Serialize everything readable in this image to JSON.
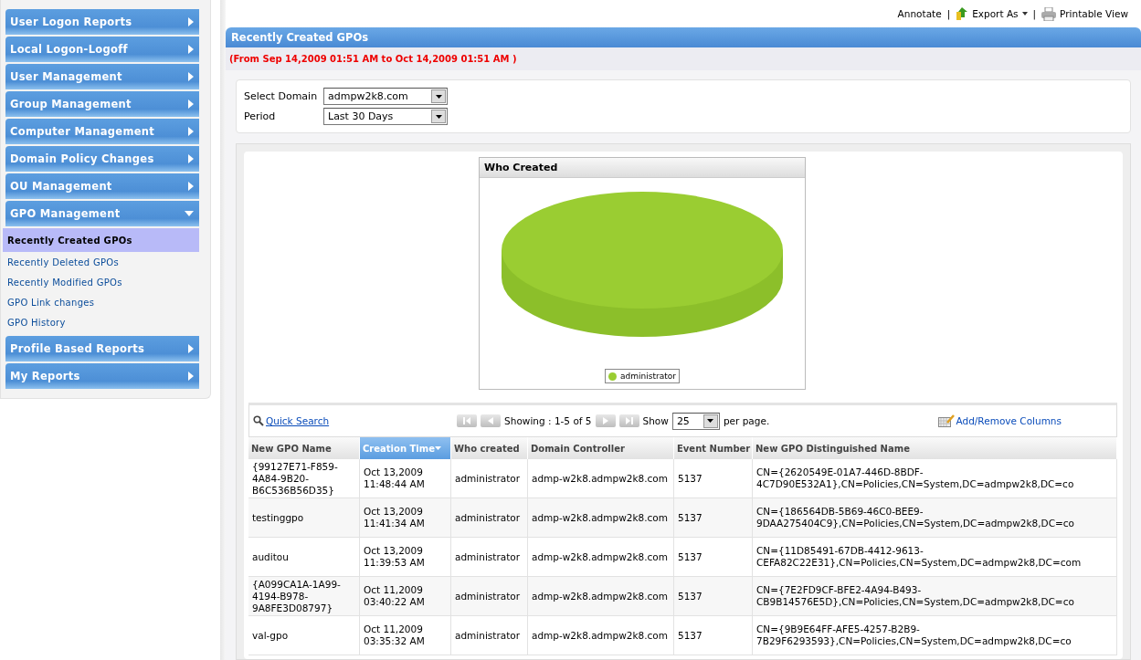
{
  "sidebar": {
    "items": [
      {
        "label": "User Logon Reports",
        "expanded": false
      },
      {
        "label": "Local Logon-Logoff",
        "expanded": false
      },
      {
        "label": "User Management",
        "expanded": false
      },
      {
        "label": "Group Management",
        "expanded": false
      },
      {
        "label": "Computer Management",
        "expanded": false
      },
      {
        "label": "Domain Policy Changes",
        "expanded": false
      },
      {
        "label": "OU Management",
        "expanded": false
      },
      {
        "label": "GPO Management",
        "expanded": true,
        "children": [
          {
            "label": "Recently Created GPOs",
            "selected": true
          },
          {
            "label": "Recently Deleted GPOs",
            "selected": false
          },
          {
            "label": "Recently Modified GPOs",
            "selected": false
          },
          {
            "label": "GPO Link changes",
            "selected": false
          },
          {
            "label": "GPO History",
            "selected": false
          }
        ]
      },
      {
        "label": "Profile Based Reports",
        "expanded": false
      },
      {
        "label": "My Reports",
        "expanded": false
      }
    ]
  },
  "top_links": [
    {
      "label": "Annotate",
      "kind": "text"
    },
    {
      "label": "|",
      "kind": "separator"
    },
    {
      "label": "Export As",
      "kind": "export"
    },
    {
      "label": "|",
      "kind": "separator"
    },
    {
      "label": "Printable View",
      "kind": "print"
    }
  ],
  "report": {
    "title": "Recently Created GPOs",
    "period_note": "(From Sep 14,2009 01:51 AM to Oct 14,2009 01:51 AM )"
  },
  "filters": [
    {
      "label": "Select Domain",
      "value": "admpw2k8.com"
    },
    {
      "label": "Period",
      "value": "Last 30 Days"
    }
  ],
  "chart": {
    "title": "Who Created",
    "legend": [
      {
        "label": "administrator",
        "color": "#9acd32"
      }
    ]
  },
  "table_toolbar": {
    "quick_search": "Quick Search",
    "showing": "Showing : 1-5 of 5",
    "show_label": "Show",
    "page_size": "25",
    "per_page": "per page.",
    "add_remove": "Add/Remove Columns"
  },
  "table": {
    "columns": [
      {
        "label": "New GPO Name",
        "selected": false
      },
      {
        "label": "Creation Time",
        "selected": true
      },
      {
        "label": "Who created",
        "selected": false
      },
      {
        "label": "Domain Controller",
        "selected": false
      },
      {
        "label": "Event Number",
        "selected": false
      },
      {
        "label": "New GPO Distinguished Name",
        "selected": false
      }
    ],
    "rows": [
      [
        "{99127E71-F859-4A84-9B20-B6C536B56D35}",
        "Oct 13,2009 11:48:44 AM",
        "administrator",
        "admp-w2k8.admpw2k8.com",
        "5137",
        "CN={2620549E-01A7-446D-8BDF-4C7D90E532A1},CN=Policies,CN=System,DC=admpw2k8,DC=co"
      ],
      [
        "testinggpo",
        "Oct 13,2009 11:41:34 AM",
        "administrator",
        "admp-w2k8.admpw2k8.com",
        "5137",
        "CN={186564DB-5B69-46C0-BEE9-9DAA275404C9},CN=Policies,CN=System,DC=admpw2k8,DC=co"
      ],
      [
        "auditou",
        "Oct 13,2009 11:39:53 AM",
        "administrator",
        "admp-w2k8.admpw2k8.com",
        "5137",
        "CN={11D85491-67DB-4412-9613-CEFA82C22E31},CN=Policies,CN=System,DC=admpw2k8,DC=com"
      ],
      [
        "{A099CA1A-1A99-4194-B978-9A8FE3D08797}",
        "Oct 11,2009 03:40:22 AM",
        "administrator",
        "admp-w2k8.admpw2k8.com",
        "5137",
        "CN={7E2FD9CF-BFE2-4A94-B493-CB9B14576E5D},CN=Policies,CN=System,DC=admpw2k8,DC=co"
      ],
      [
        "val-gpo",
        "Oct 11,2009 03:35:32 AM",
        "administrator",
        "admp-w2k8.admpw2k8.com",
        "5137",
        "CN={9B9E64FF-AFE5-4257-B2B9-7B29F6293593},CN=Policies,CN=System,DC=admpw2k8,DC=co"
      ]
    ]
  }
}
